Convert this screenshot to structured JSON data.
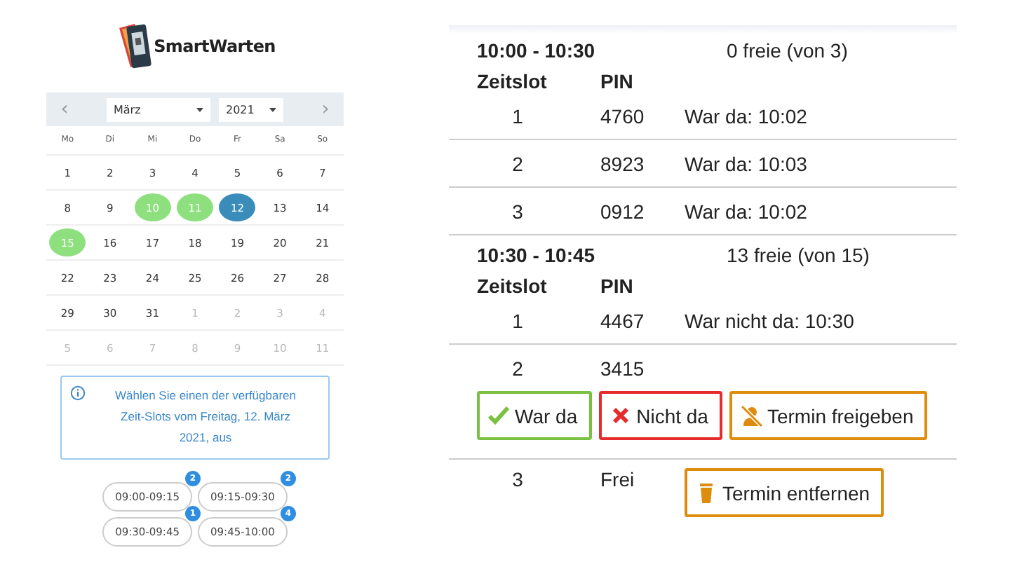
{
  "logo": {
    "text": "SmartWarten"
  },
  "calendar": {
    "month": "März",
    "year": "2021",
    "prev": "‹",
    "next": "›",
    "weekdays": [
      "Mo",
      "Di",
      "Mi",
      "Do",
      "Fr",
      "Sa",
      "So"
    ],
    "weeks": [
      [
        {
          "day": "1",
          "kind": "normal"
        },
        {
          "day": "2",
          "kind": "normal"
        },
        {
          "day": "3",
          "kind": "normal"
        },
        {
          "day": "4",
          "kind": "normal"
        },
        {
          "day": "5",
          "kind": "normal"
        },
        {
          "day": "6",
          "kind": "normal"
        },
        {
          "day": "7",
          "kind": "normal"
        }
      ],
      [
        {
          "day": "8",
          "kind": "normal"
        },
        {
          "day": "9",
          "kind": "normal"
        },
        {
          "day": "10",
          "kind": "available"
        },
        {
          "day": "11",
          "kind": "available"
        },
        {
          "day": "12",
          "kind": "selected"
        },
        {
          "day": "13",
          "kind": "normal"
        },
        {
          "day": "14",
          "kind": "normal"
        }
      ],
      [
        {
          "day": "15",
          "kind": "available"
        },
        {
          "day": "16",
          "kind": "normal"
        },
        {
          "day": "17",
          "kind": "normal"
        },
        {
          "day": "18",
          "kind": "normal"
        },
        {
          "day": "19",
          "kind": "normal"
        },
        {
          "day": "20",
          "kind": "normal"
        },
        {
          "day": "21",
          "kind": "normal"
        }
      ],
      [
        {
          "day": "22",
          "kind": "normal"
        },
        {
          "day": "23",
          "kind": "normal"
        },
        {
          "day": "24",
          "kind": "normal"
        },
        {
          "day": "25",
          "kind": "normal"
        },
        {
          "day": "26",
          "kind": "normal"
        },
        {
          "day": "27",
          "kind": "normal"
        },
        {
          "day": "28",
          "kind": "normal"
        }
      ],
      [
        {
          "day": "29",
          "kind": "normal"
        },
        {
          "day": "30",
          "kind": "normal"
        },
        {
          "day": "31",
          "kind": "normal"
        },
        {
          "day": "1",
          "kind": "other"
        },
        {
          "day": "2",
          "kind": "other"
        },
        {
          "day": "3",
          "kind": "other"
        },
        {
          "day": "4",
          "kind": "other"
        }
      ],
      [
        {
          "day": "5",
          "kind": "other"
        },
        {
          "day": "6",
          "kind": "other"
        },
        {
          "day": "7",
          "kind": "other"
        },
        {
          "day": "8",
          "kind": "other"
        },
        {
          "day": "9",
          "kind": "other"
        },
        {
          "day": "10",
          "kind": "other"
        },
        {
          "day": "11",
          "kind": "other"
        }
      ]
    ]
  },
  "info": "Wählen Sie einen der verfügbaren Zeit-Slots vom Freitag, 12. März 2021, aus",
  "slots": [
    {
      "time": "09:00-09:15",
      "count": "2"
    },
    {
      "time": "09:15-09:30",
      "count": "2"
    },
    {
      "time": "09:30-09:45",
      "count": "1"
    },
    {
      "time": "09:45-10:00",
      "count": "4"
    }
  ],
  "groups": [
    {
      "time": "10:00 - 10:30",
      "free": "0 freie (von 3)",
      "columns": [
        "Zeitslot",
        "PIN"
      ],
      "rows": [
        {
          "slot": "1",
          "pin": "4760",
          "note": "War da: 10:02"
        },
        {
          "slot": "2",
          "pin": "8923",
          "note": "War da: 10:03"
        },
        {
          "slot": "3",
          "pin": "0912",
          "note": "War da: 10:02"
        }
      ]
    },
    {
      "time": "10:30 - 10:45",
      "free": "13 freie (von 15)",
      "columns": [
        "Zeitslot",
        "PIN"
      ],
      "rows": [
        {
          "slot": "1",
          "pin": "4467",
          "note": "War nicht da: 10:30"
        },
        {
          "slot": "2",
          "pin": "3415",
          "actions": [
            {
              "kind": "present",
              "label": "War da"
            },
            {
              "kind": "absent",
              "label": "Nicht da"
            },
            {
              "kind": "release",
              "label": "Termin freigeben"
            }
          ]
        },
        {
          "slot": "3",
          "pin": "Frei",
          "actions": [
            {
              "kind": "remove",
              "label": "Termin entfernen"
            }
          ]
        }
      ]
    }
  ]
}
